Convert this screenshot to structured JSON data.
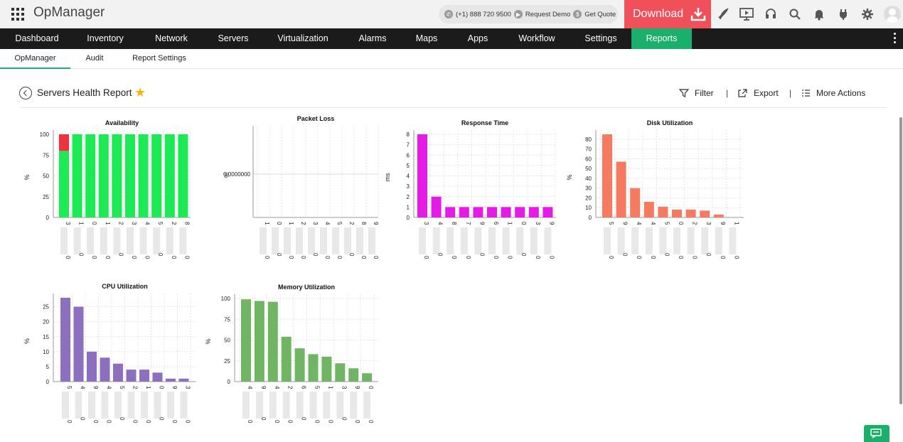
{
  "app": {
    "title": "OpManager"
  },
  "contact": {
    "phone": "(+1) 888 720 9500",
    "demo": "Request Demo",
    "quote": "Get Quote"
  },
  "download": {
    "label": "Download"
  },
  "top_icons": [
    "rocket-icon",
    "presentation-icon",
    "headset-icon",
    "search-icon",
    "bell-icon",
    "plug-icon",
    "gear-icon"
  ],
  "mainnav": {
    "items": [
      "Dashboard",
      "Inventory",
      "Network",
      "Servers",
      "Virtualization",
      "Alarms",
      "Maps",
      "Apps",
      "Workflow",
      "Settings",
      "Reports"
    ],
    "active": "Reports"
  },
  "subnav": {
    "items": [
      "OpManager",
      "Audit",
      "Report Settings"
    ],
    "active": "OpManager"
  },
  "report": {
    "title": "Servers Health Report",
    "actions": {
      "filter": "Filter",
      "export": "Export",
      "more": "More Actions"
    }
  },
  "colors": {
    "accent": "#1ab06b",
    "download": "#f0505a",
    "availability_up": "#1bea55",
    "availability_down": "#f0323c",
    "response": "#e61ae6",
    "disk": "#f57a5f",
    "cpu": "#8c6fbe",
    "memory": "#6fb563"
  },
  "chart_data": [
    {
      "type": "bar",
      "title": "Availability",
      "ylabel": "%",
      "ylim": [
        0,
        100
      ],
      "yticks": [
        0,
        25,
        50,
        75,
        100
      ],
      "categories": [
        "3",
        "1",
        "0",
        "1",
        "2",
        "3",
        "4",
        "5",
        "2",
        "8"
      ],
      "bottom_labels": [
        "0",
        "0",
        "0",
        "0",
        "0",
        "0",
        "0",
        "0",
        "0",
        "0"
      ],
      "stacked": true,
      "series": [
        {
          "values": [
            80,
            100,
            100,
            100,
            100,
            100,
            100,
            100,
            100,
            100
          ]
        },
        {
          "values": [
            20,
            0,
            0,
            0,
            0,
            0,
            0,
            0,
            0,
            0
          ]
        }
      ]
    },
    {
      "type": "bar",
      "title": "Packet Loss",
      "ylabel": "%",
      "ylim": [
        0,
        0
      ],
      "yticks_labels": [
        "0.0000000"
      ],
      "categories": [
        "1",
        "0",
        "1",
        "2",
        "3",
        "4",
        "5",
        "2",
        "8",
        "9"
      ],
      "bottom_labels": [
        "0",
        "0",
        "0",
        "0",
        "0",
        "0",
        "0",
        "0",
        "0",
        "0"
      ],
      "values": [
        0,
        0,
        0,
        0,
        0,
        0,
        0,
        0,
        0,
        0
      ]
    },
    {
      "type": "bar",
      "title": "Response Time",
      "ylabel": "ms",
      "ylim": [
        0,
        8
      ],
      "yticks": [
        0,
        1,
        2,
        3,
        4,
        5,
        6,
        7,
        8
      ],
      "categories": [
        "3",
        "4",
        "8",
        "7",
        "9",
        "6",
        "1",
        "0",
        "3",
        "9"
      ],
      "bottom_labels": [
        "0",
        "0",
        "0",
        "0",
        "0",
        "0",
        "0",
        "0",
        "0",
        "0"
      ],
      "values": [
        8,
        2,
        1,
        1,
        1,
        1,
        1,
        1,
        1,
        1
      ]
    },
    {
      "type": "bar",
      "title": "Disk Utilization",
      "ylabel": "%",
      "ylim": [
        0,
        85
      ],
      "yticks": [
        0,
        10,
        20,
        30,
        40,
        50,
        60,
        70,
        80
      ],
      "categories": [
        "5",
        "9",
        "4",
        "4",
        "5",
        "0",
        "2",
        "3",
        "9",
        "1"
      ],
      "bottom_labels": [
        "0",
        "0",
        "0",
        "0",
        "0",
        "0",
        "0",
        "0",
        "0",
        "0"
      ],
      "values": [
        85,
        57,
        30,
        16,
        11,
        8,
        8,
        7,
        3,
        0
      ]
    },
    {
      "type": "bar",
      "title": "CPU Utilization",
      "ylabel": "%",
      "ylim": [
        0,
        28
      ],
      "yticks": [
        0,
        5,
        10,
        15,
        20,
        25
      ],
      "categories": [
        "5",
        "4",
        "9",
        "4",
        "5",
        "2",
        "1",
        "0",
        "9",
        "3"
      ],
      "bottom_labels": [
        "0",
        "0",
        "0",
        "0",
        "0",
        "0",
        "0",
        "0",
        "0",
        "0"
      ],
      "values": [
        28,
        25,
        10,
        8,
        6,
        4,
        4,
        3,
        1,
        1
      ]
    },
    {
      "type": "bar",
      "title": "Memory Utilization",
      "ylabel": "%",
      "ylim": [
        0,
        100
      ],
      "yticks": [
        0,
        25,
        50,
        75,
        100
      ],
      "categories": [
        "4",
        "9",
        "4",
        "2",
        "6",
        "5",
        "1",
        "3",
        "9",
        "0"
      ],
      "bottom_labels": [
        "0",
        "0",
        "0",
        "0",
        "0",
        "0",
        "0",
        "0",
        "0",
        "0"
      ],
      "values": [
        99,
        97,
        96,
        54,
        40,
        33,
        30,
        22,
        16,
        10
      ]
    }
  ]
}
